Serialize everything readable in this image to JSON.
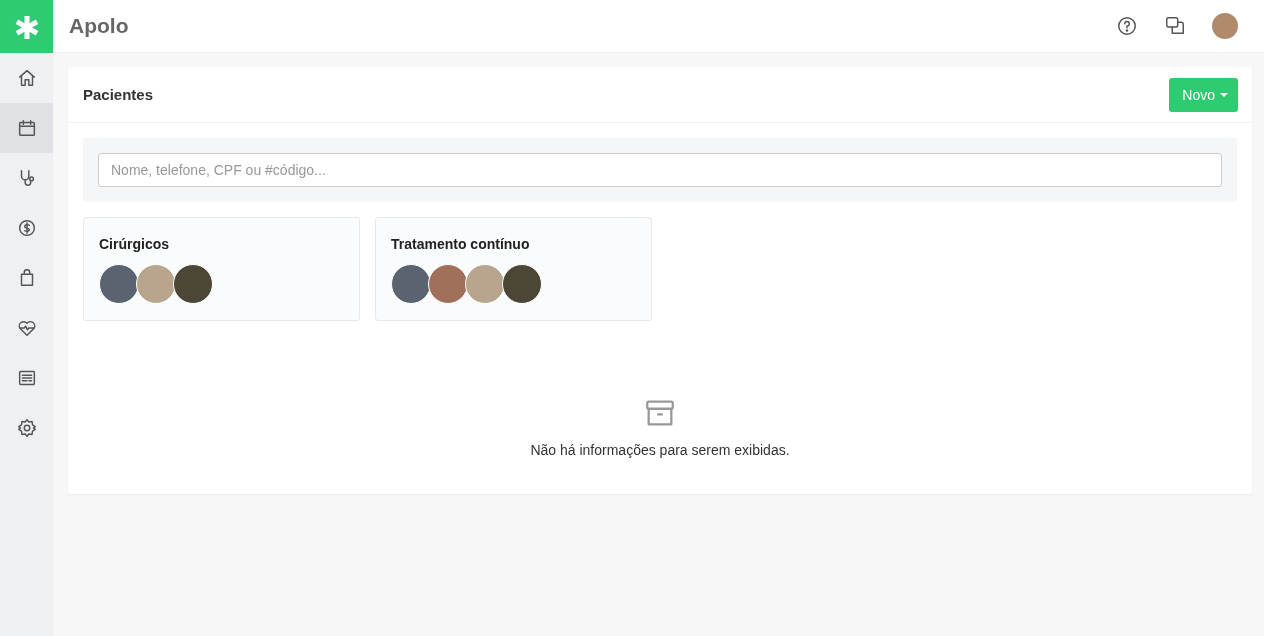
{
  "app": {
    "title": "Apolo"
  },
  "sidebar": {
    "items": [
      {
        "kind": "home",
        "selected": false
      },
      {
        "kind": "calendar",
        "selected": true
      },
      {
        "kind": "stethoscope",
        "selected": false
      },
      {
        "kind": "money",
        "selected": false
      },
      {
        "kind": "bag",
        "selected": false
      },
      {
        "kind": "heart",
        "selected": false
      },
      {
        "kind": "report",
        "selected": false
      },
      {
        "kind": "settings",
        "selected": false
      }
    ]
  },
  "panel": {
    "title": "Pacientes",
    "new_button": "Novo",
    "search": {
      "placeholder": "Nome, telefone, CPF ou #código..."
    },
    "groups": [
      {
        "title": "Cirúrgicos",
        "avatars": [
          {
            "color": "#5a6470"
          },
          {
            "color": "#b9a58e"
          },
          {
            "color": "#4b4636"
          }
        ]
      },
      {
        "title": "Tratamento contínuo",
        "avatars": [
          {
            "color": "#5a6470"
          },
          {
            "color": "#a0705a"
          },
          {
            "color": "#b9a58e"
          },
          {
            "color": "#4b4636"
          }
        ]
      }
    ],
    "empty_message": "Não há informações para serem exibidas."
  }
}
